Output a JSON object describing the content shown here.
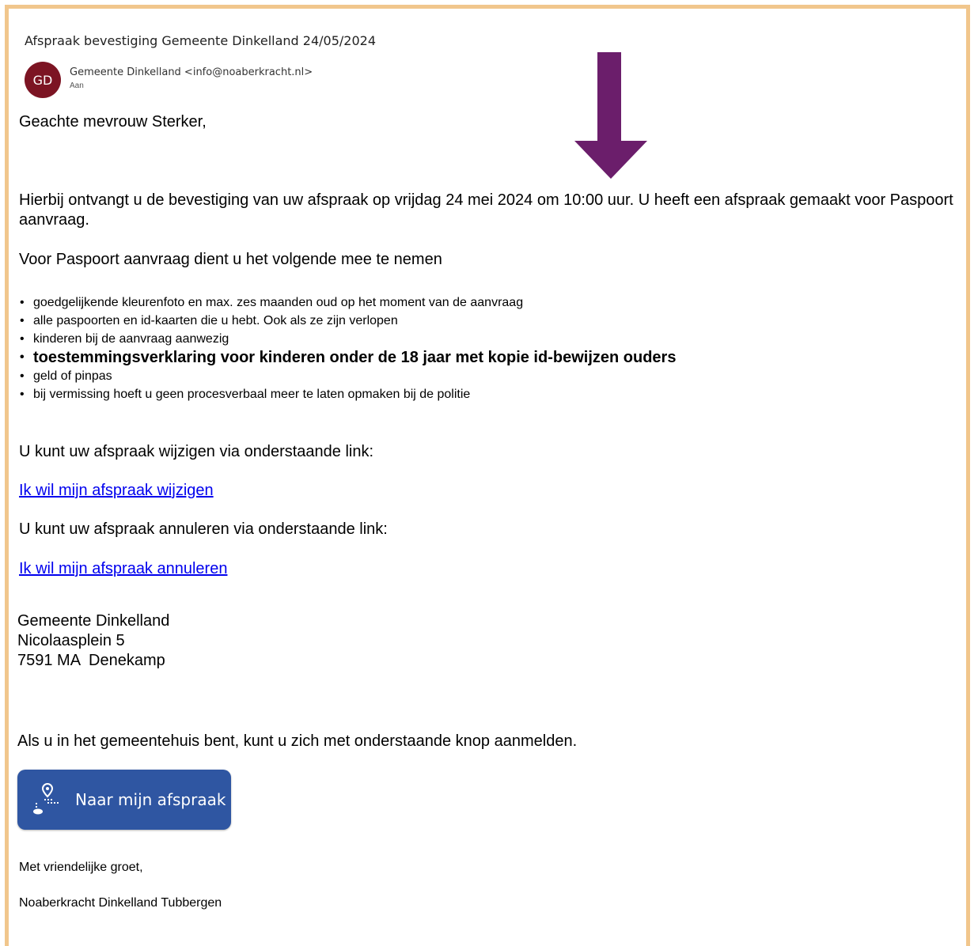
{
  "email": {
    "subject_line": "Afspraak bevestiging Gemeente Dinkelland  24/05/2024",
    "avatar_initials": "GD",
    "sender": "Gemeente Dinkelland <info@noaberkracht.nl>",
    "to_label": "Aan"
  },
  "body": {
    "salutation": "Geachte mevrouw Sterker,",
    "confirmation": "Hierbij ontvangt u de bevestiging van uw afspraak op vrijdag 24 mei 2024 om 10:00 uur. U heeft een afspraak gemaakt voor Paspoort aanvraag.",
    "bring_intro": "Voor Paspoort aanvraag dient u het volgende mee te nemen",
    "items": [
      " goedgelijkende kleurenfoto en max. zes maanden oud op het moment van de aanvraag",
      "alle paspoorten en id-kaarten die u hebt. Ook als ze zijn verlopen",
      "kinderen bij de aanvraag aanwezig",
      "toestemmingsverklaring voor kinderen onder de 18 jaar met kopie id-bewijzen ouders",
      "geld of pinpas",
      "bij vermissing hoeft u geen procesverbaal meer te laten opmaken bij de politie"
    ],
    "change_text": "U kunt uw afspraak wijzigen via onderstaande link:",
    "change_link": "Ik wil mijn afspraak wijzigen",
    "cancel_text": "U kunt uw afspraak annuleren via onderstaande link:",
    "cancel_link": "Ik wil mijn afspraak annuleren",
    "address": {
      "name": "Gemeente Dinkelland",
      "street": "Nicolaasplein 5",
      "city": "7591 MA  Denekamp"
    },
    "checkin_text": "Als u in het gemeentehuis bent, kunt u zich met onderstaande knop aanmelden.",
    "button_label": "Naar mijn afspraak",
    "button_icon": "location-route-icon",
    "closing": "Met vriendelijke groet,",
    "signature": "Noaberkracht Dinkelland Tubbergen"
  },
  "annotation": {
    "arrow_color": "#6b1e6b"
  },
  "colors": {
    "frame": "#f1c68c",
    "avatar": "#7c1423",
    "button": "#2f56a2",
    "link": "#0000ee"
  }
}
